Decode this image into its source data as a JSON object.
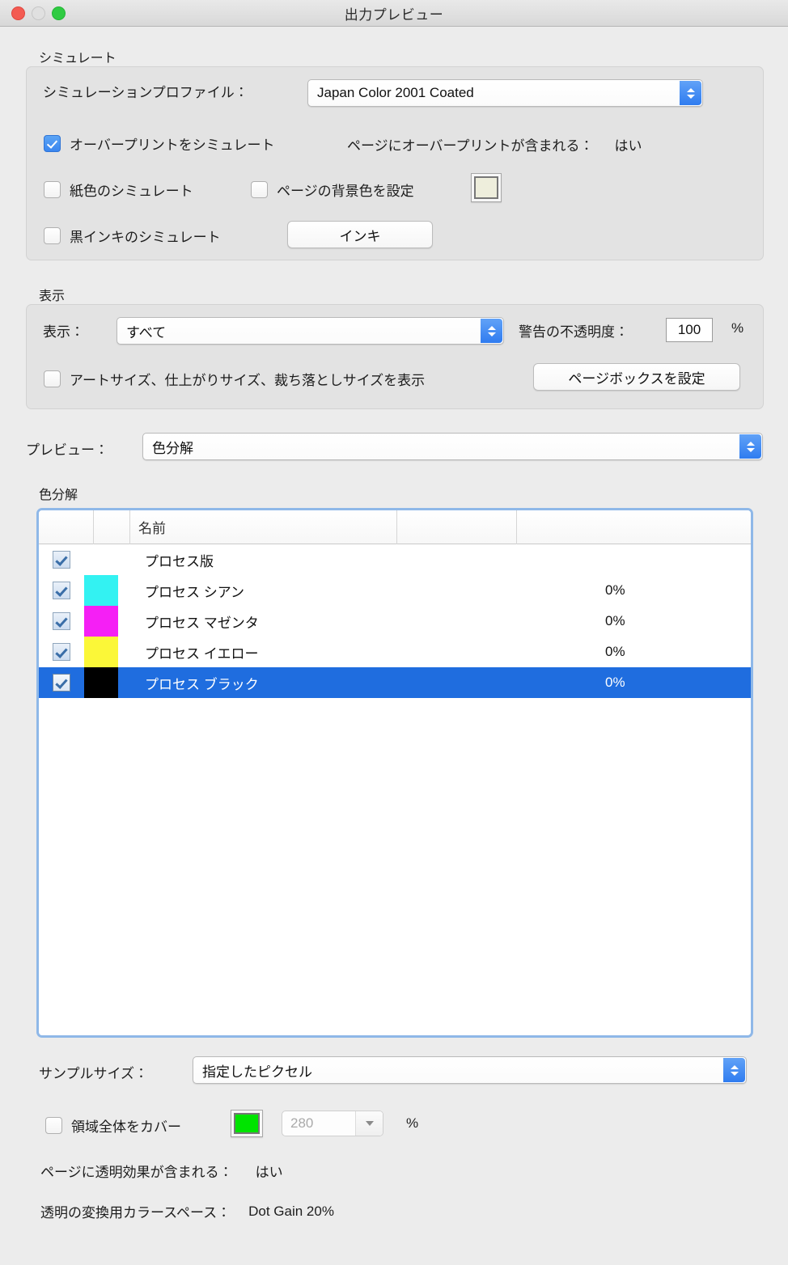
{
  "window": {
    "title": "出力プレビュー",
    "traffic_lights": [
      "close-button",
      "minimize-button",
      "zoom-button"
    ]
  },
  "colors": {
    "accent": "#2f7cf0",
    "selection": "#1f6ddf",
    "focus_ring": "#8fb8e8",
    "window_bg": "#ececec",
    "group_bg": "#e3e3e3",
    "page_bg_swatch": "#eeeedc",
    "coverage_swatch": "#00e400"
  },
  "simulate_section": {
    "legend": "シミュレート",
    "profile_label": "シミュレーションプロファイル：",
    "profile_value": "Japan Color 2001 Coated",
    "overprint_checkbox": {
      "label": "オーバープリントをシミュレート",
      "checked": true
    },
    "overprint_info_label": "ページにオーバープリントが含まれる：",
    "overprint_info_value": "はい",
    "paper_color_checkbox": {
      "label": "紙色のシミュレート",
      "checked": false
    },
    "page_bg_checkbox": {
      "label": "ページの背景色を設定",
      "checked": false
    },
    "black_ink_checkbox": {
      "label": "黒インキのシミュレート",
      "checked": false
    },
    "ink_button": "インキ"
  },
  "display_section": {
    "legend": "表示",
    "show_label": "表示：",
    "show_value": "すべて",
    "warning_opacity_label": "警告の不透明度：",
    "warning_opacity_value": "100",
    "percent_sign": "%",
    "sizes_checkbox": {
      "label": "アートサイズ、仕上がりサイズ、裁ち落としサイズを表示",
      "checked": false
    },
    "page_boxes_button": "ページボックスを設定"
  },
  "preview_row": {
    "label": "プレビュー：",
    "value": "色分解"
  },
  "separations": {
    "legend": "色分解",
    "columns": [
      "",
      "",
      "名前",
      "",
      ""
    ],
    "name_column_header": "名前",
    "rows": [
      {
        "checked": true,
        "swatch": null,
        "name": "プロセス版",
        "percent": "",
        "selected": false
      },
      {
        "checked": true,
        "swatch": "#33f2f2",
        "name": "プロセス シアン",
        "percent": "0%",
        "selected": false
      },
      {
        "checked": true,
        "swatch": "#f51ff5",
        "name": "プロセス マゼンタ",
        "percent": "0%",
        "selected": false
      },
      {
        "checked": true,
        "swatch": "#fbf738",
        "name": "プロセス イエロー",
        "percent": "0%",
        "selected": false
      },
      {
        "checked": true,
        "swatch": "#000000",
        "name": "プロセス ブラック",
        "percent": "0%",
        "selected": true
      }
    ]
  },
  "sample_row": {
    "label": "サンプルサイズ：",
    "value": "指定したピクセル"
  },
  "coverage_row": {
    "checkbox": {
      "label": "領域全体をカバー",
      "checked": false
    },
    "threshold_value": "280",
    "percent_sign": "%"
  },
  "footer": {
    "transparency_label": "ページに透明効果が含まれる：",
    "transparency_value": "はい",
    "colorspace_label": "透明の変換用カラースペース：",
    "colorspace_value": "Dot Gain 20%"
  }
}
